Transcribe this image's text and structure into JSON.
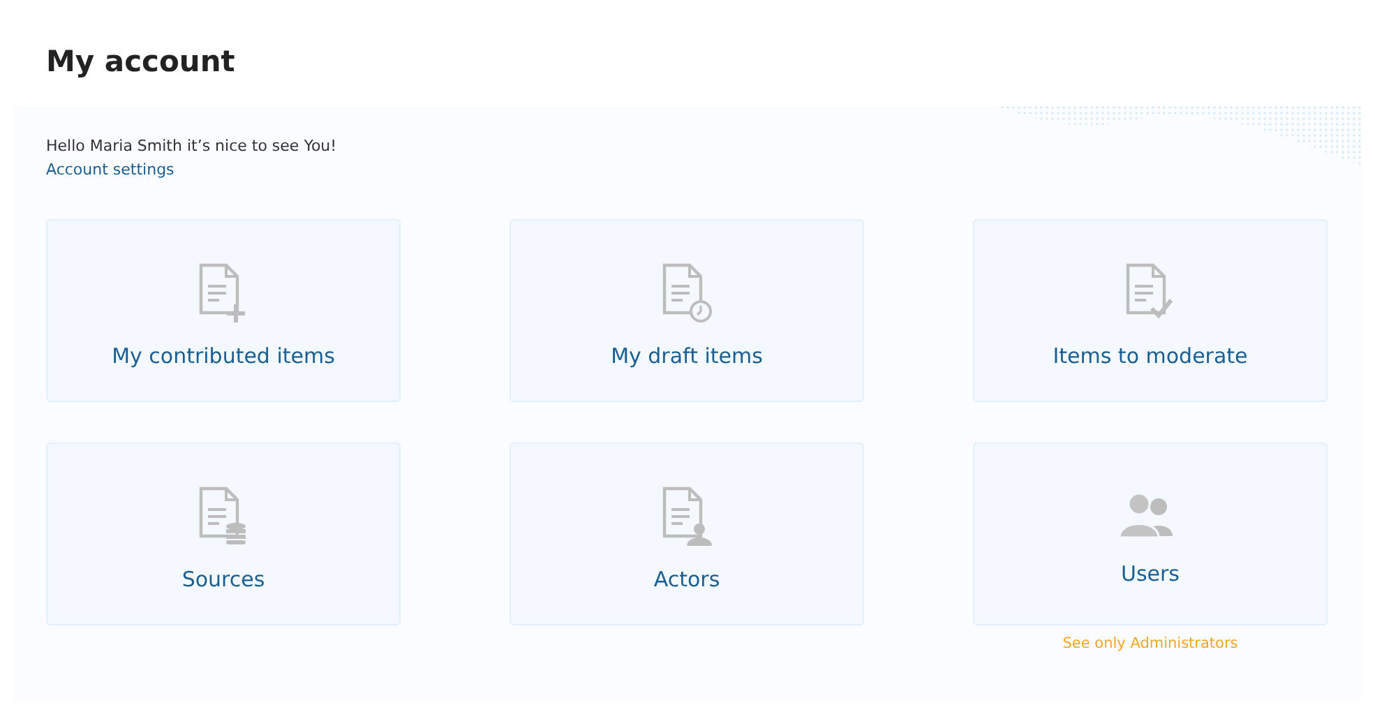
{
  "title": "My account",
  "greeting": "Hello Maria Smith it’s nice to see You!",
  "settings_link": "Account settings",
  "cards": [
    {
      "label": "My contributed items",
      "kind": "add"
    },
    {
      "label": "My draft items",
      "kind": "clock"
    },
    {
      "label": "Items to moderate",
      "kind": "check"
    },
    {
      "label": "Sources",
      "kind": "database"
    },
    {
      "label": "Actors",
      "kind": "person"
    },
    {
      "label": "Users",
      "kind": "users",
      "note": "See only Administrators"
    }
  ]
}
